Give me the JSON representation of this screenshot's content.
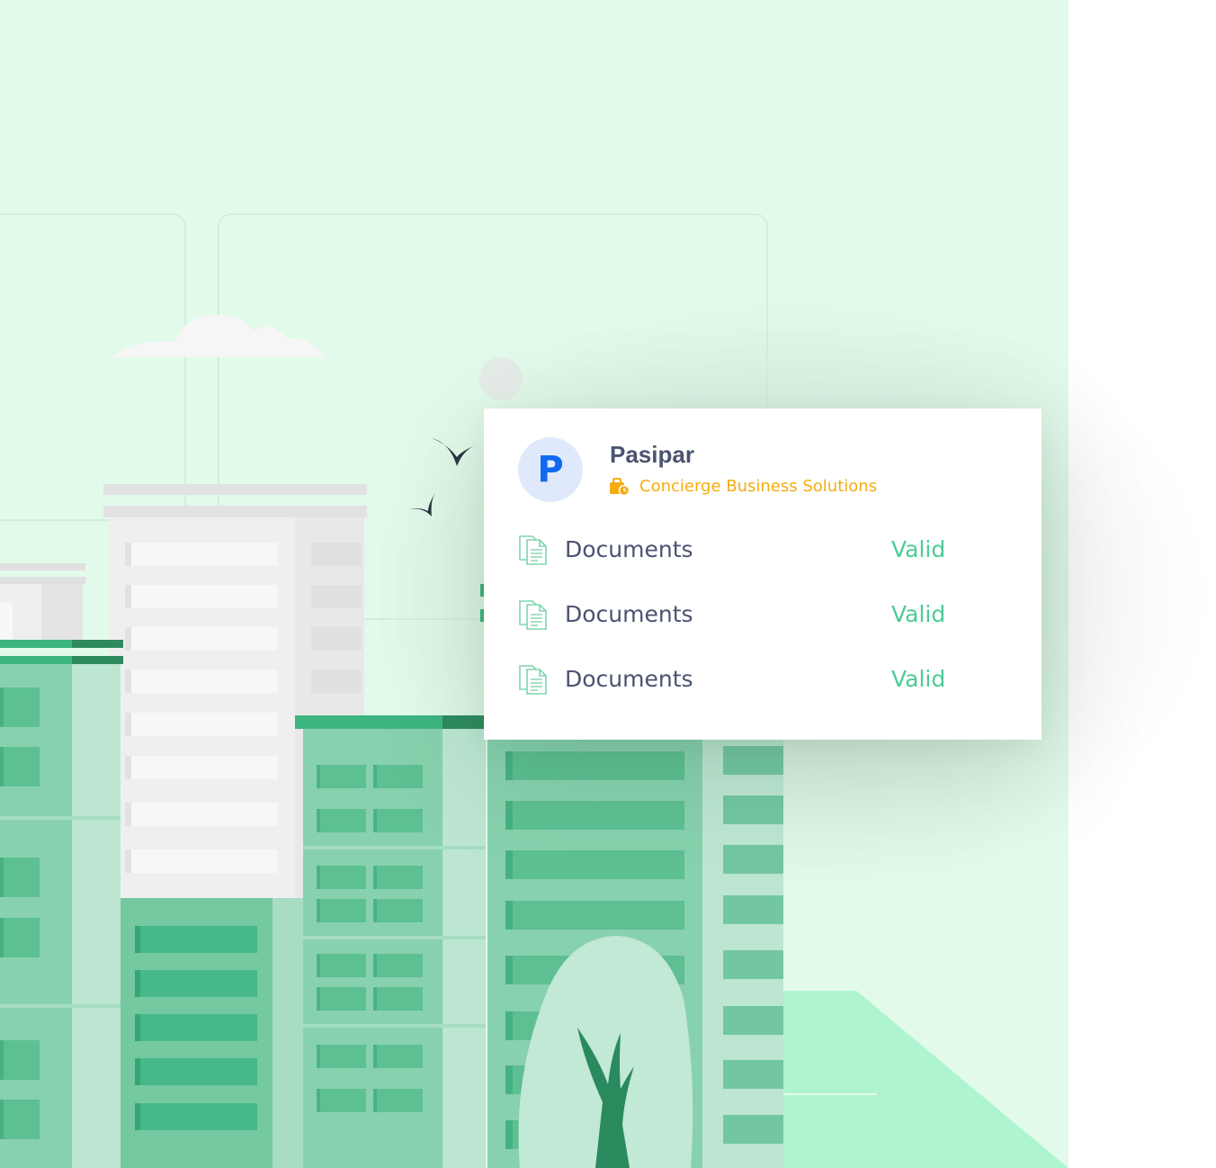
{
  "card": {
    "avatar_letter": "P",
    "company_name": "Pasipar",
    "company_subtitle": "Concierge Business Solutions",
    "documents": [
      {
        "label": "Documents",
        "status": "Valid"
      },
      {
        "label": "Documents",
        "status": "Valid"
      },
      {
        "label": "Documents",
        "status": "Valid"
      }
    ]
  },
  "colors": {
    "background": "#e2faea",
    "avatar_bg": "#dfe9fb",
    "avatar_text": "#1169f0",
    "company_name": "#4a5370",
    "subtitle": "#f4ac12",
    "valid": "#4ccc94",
    "building_green": "#88d1ae"
  },
  "icons": {
    "subtitle_icon": "briefcase-clock-icon",
    "document_icon": "document-icon"
  }
}
